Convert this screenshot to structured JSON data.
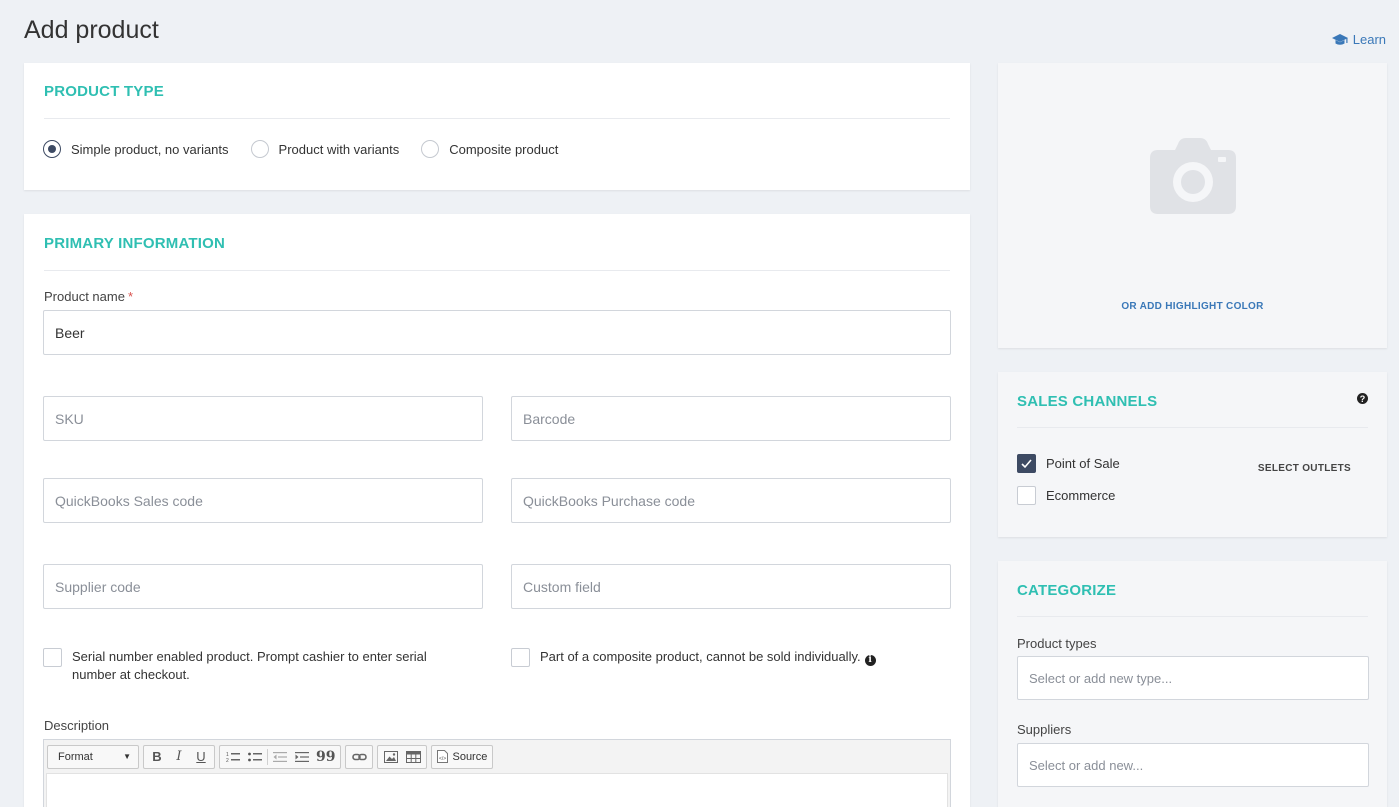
{
  "header": {
    "title": "Add product",
    "learn_label": "Learn"
  },
  "product_type": {
    "title": "PRODUCT TYPE",
    "options": [
      {
        "label": "Simple product, no variants",
        "selected": true
      },
      {
        "label": "Product with variants",
        "selected": false
      },
      {
        "label": "Composite product",
        "selected": false
      }
    ]
  },
  "primary": {
    "title": "PRIMARY INFORMATION",
    "product_name_label": "Product name",
    "required_mark": "*",
    "product_name_value": "Beer",
    "sku_placeholder": "SKU",
    "barcode_placeholder": "Barcode",
    "qb_sales_placeholder": "QuickBooks Sales code",
    "qb_purchase_placeholder": "QuickBooks Purchase code",
    "supplier_code_placeholder": "Supplier code",
    "custom_field_placeholder": "Custom field",
    "serial_label": "Serial number enabled product. Prompt cashier to enter serial number at checkout.",
    "composite_label": "Part of a composite product, cannot be sold individually.",
    "description_label": "Description",
    "editor": {
      "format_label": "Format",
      "bold": "B",
      "italic": "I",
      "underline": "U",
      "quote": "99",
      "source_label": "Source"
    }
  },
  "image_panel": {
    "highlight_label": "OR ADD HIGHLIGHT COLOR"
  },
  "sales_channels": {
    "title": "SALES CHANNELS",
    "help_glyph": "?",
    "select_outlets_label": "SELECT OUTLETS",
    "channels": [
      {
        "label": "Point of Sale",
        "checked": true
      },
      {
        "label": "Ecommerce",
        "checked": false
      }
    ]
  },
  "categorize": {
    "title": "CATEGORIZE",
    "product_types_label": "Product types",
    "product_types_placeholder": "Select or add new type...",
    "suppliers_label": "Suppliers",
    "suppliers_placeholder": "Select or add new..."
  },
  "colors": {
    "accent": "#2fbfb2",
    "link": "#3a78b8",
    "checked": "#3d4a63"
  },
  "icons": [
    "graduation-cap-icon",
    "camera-icon",
    "info-icon",
    "help-icon",
    "check-icon"
  ]
}
